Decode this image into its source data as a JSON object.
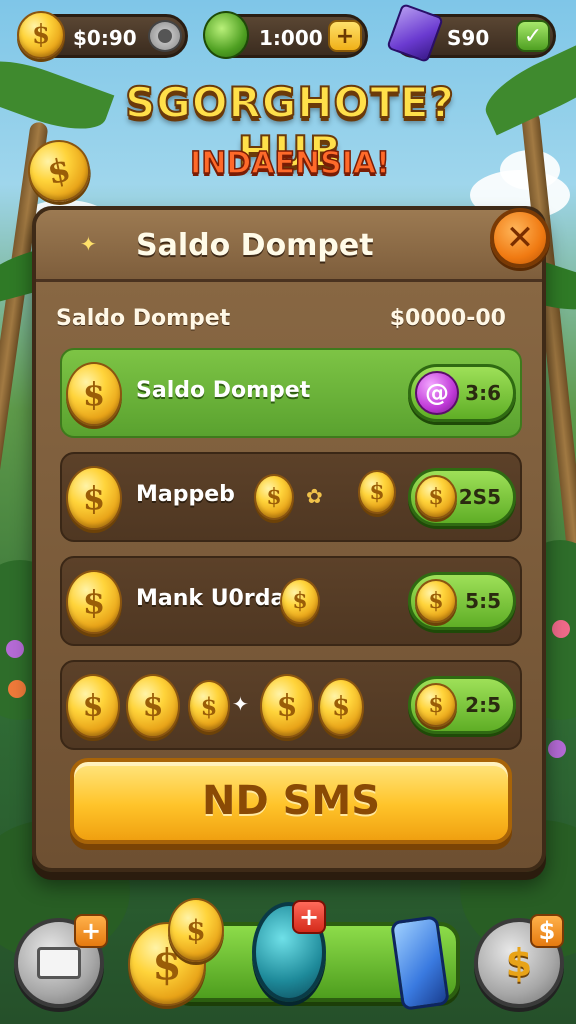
{
  "currency": {
    "coins_value": "$0:90",
    "leaf_value": "1:000",
    "gems_value": "S90"
  },
  "title": {
    "main": "SGORGHOTE? HUB",
    "sub": "INDAENSIA!"
  },
  "panel": {
    "title": "Saldo Dompet",
    "summary_label": "Saldo Dompet",
    "summary_value": "$0000-00",
    "rows": [
      {
        "label": "Saldo Dompet",
        "value": "3:6"
      },
      {
        "label": "Mappeb",
        "value": "2S5"
      },
      {
        "label": "Mank U0rda",
        "value": "5:5"
      },
      {
        "label": "",
        "value": "2:5"
      }
    ],
    "main_button": "ND SMS"
  },
  "icons": {
    "coin": "coin-icon",
    "leaf": "leaf-icon",
    "gem": "gem-icon",
    "plus": "plus-icon",
    "check": "check-icon",
    "close": "close-icon"
  },
  "colors": {
    "accent_green": "#5fae26",
    "accent_gold": "#ffc42a",
    "panel_brown": "#6e5032",
    "close_orange": "#f07a12"
  }
}
